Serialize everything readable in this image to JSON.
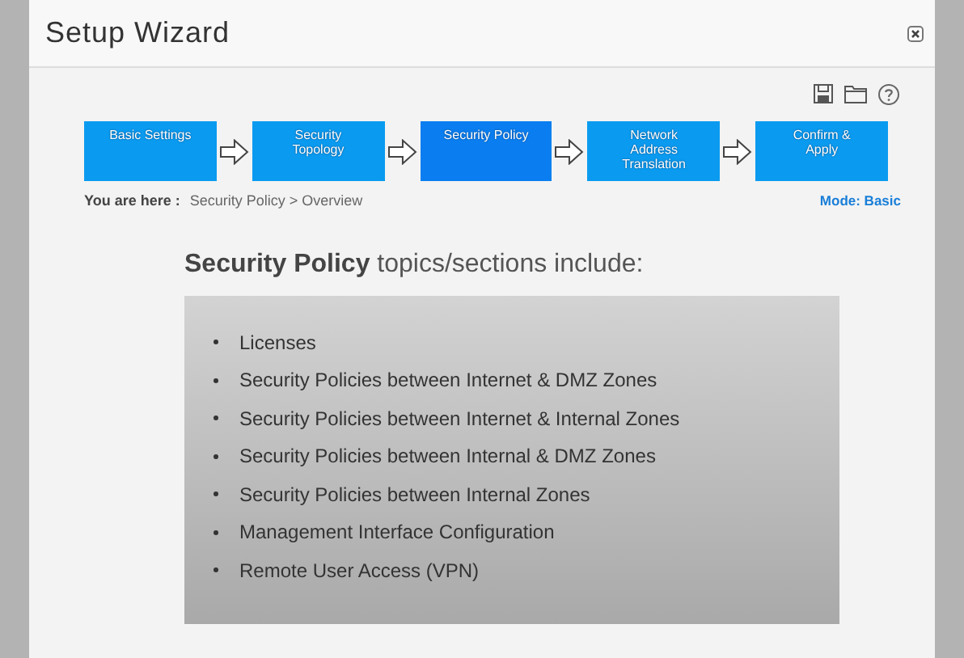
{
  "window": {
    "title": "Setup Wizard"
  },
  "steps": [
    {
      "label": "Basic Settings",
      "selected": false
    },
    {
      "label": "Security Topology",
      "selected": false
    },
    {
      "label": "Security Policy",
      "selected": true
    },
    {
      "label": "Network Address Translation",
      "selected": false
    },
    {
      "label": "Confirm & Apply",
      "selected": false
    }
  ],
  "breadcrumb": {
    "label": "You are here :",
    "path": "Security Policy > Overview"
  },
  "mode": "Mode: Basic",
  "heading": "**Security Policy** topics/sections include:",
  "topics": [
    "Licenses",
    "Security Policies between Internet & DMZ Zones",
    "Security Policies between Internet & Internal Zones",
    "Security Policies between Internal & DMZ Zones",
    "Security Policies between Internal Zones",
    "Management Interface Configuration",
    "Remote User Access (VPN)"
  ]
}
